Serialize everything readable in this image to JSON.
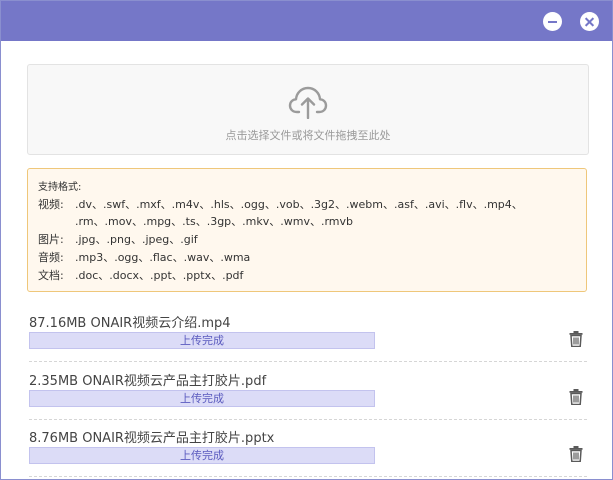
{
  "window": {
    "minimize_icon": "minus-circle-icon",
    "close_icon": "close-circle-icon",
    "accent_color": "#7577c8"
  },
  "dropzone": {
    "icon": "cloud-upload-icon",
    "hint": "点击选择文件或将文件拖拽至此处"
  },
  "formats": {
    "title": "支持格式:",
    "video_label": "视频:",
    "video_line1": ".dv、.swf、.mxf、.m4v、.hls、.ogg、.vob、.3g2、.webm、.asf、.avi、.flv、.mp4、",
    "video_line2": ".rm、.mov、.mpg、.ts、.3gp、.mkv、.wmv、.rmvb",
    "image_label": "图片:",
    "image_list": ".jpg、.png、.jpeg、.gif",
    "audio_label": "音频:",
    "audio_list": ".mp3、.ogg、.flac、.wav、.wma",
    "doc_label": "文档:",
    "doc_list": ".doc、.docx、.ppt、.pptx、.pdf"
  },
  "files": [
    {
      "name": "87.16MB  ONAIR视频云介绍.mp4",
      "status": "上传完成",
      "progress": 1.0,
      "delete_icon": "trash-icon"
    },
    {
      "name": "2.35MB  ONAIR视频云产品主打胶片.pdf",
      "status": "上传完成",
      "progress": 1.0,
      "delete_icon": "trash-icon"
    },
    {
      "name": "8.76MB  ONAIR视频云产品主打胶片.pptx",
      "status": "上传完成",
      "progress": 1.0,
      "delete_icon": "trash-icon"
    }
  ]
}
